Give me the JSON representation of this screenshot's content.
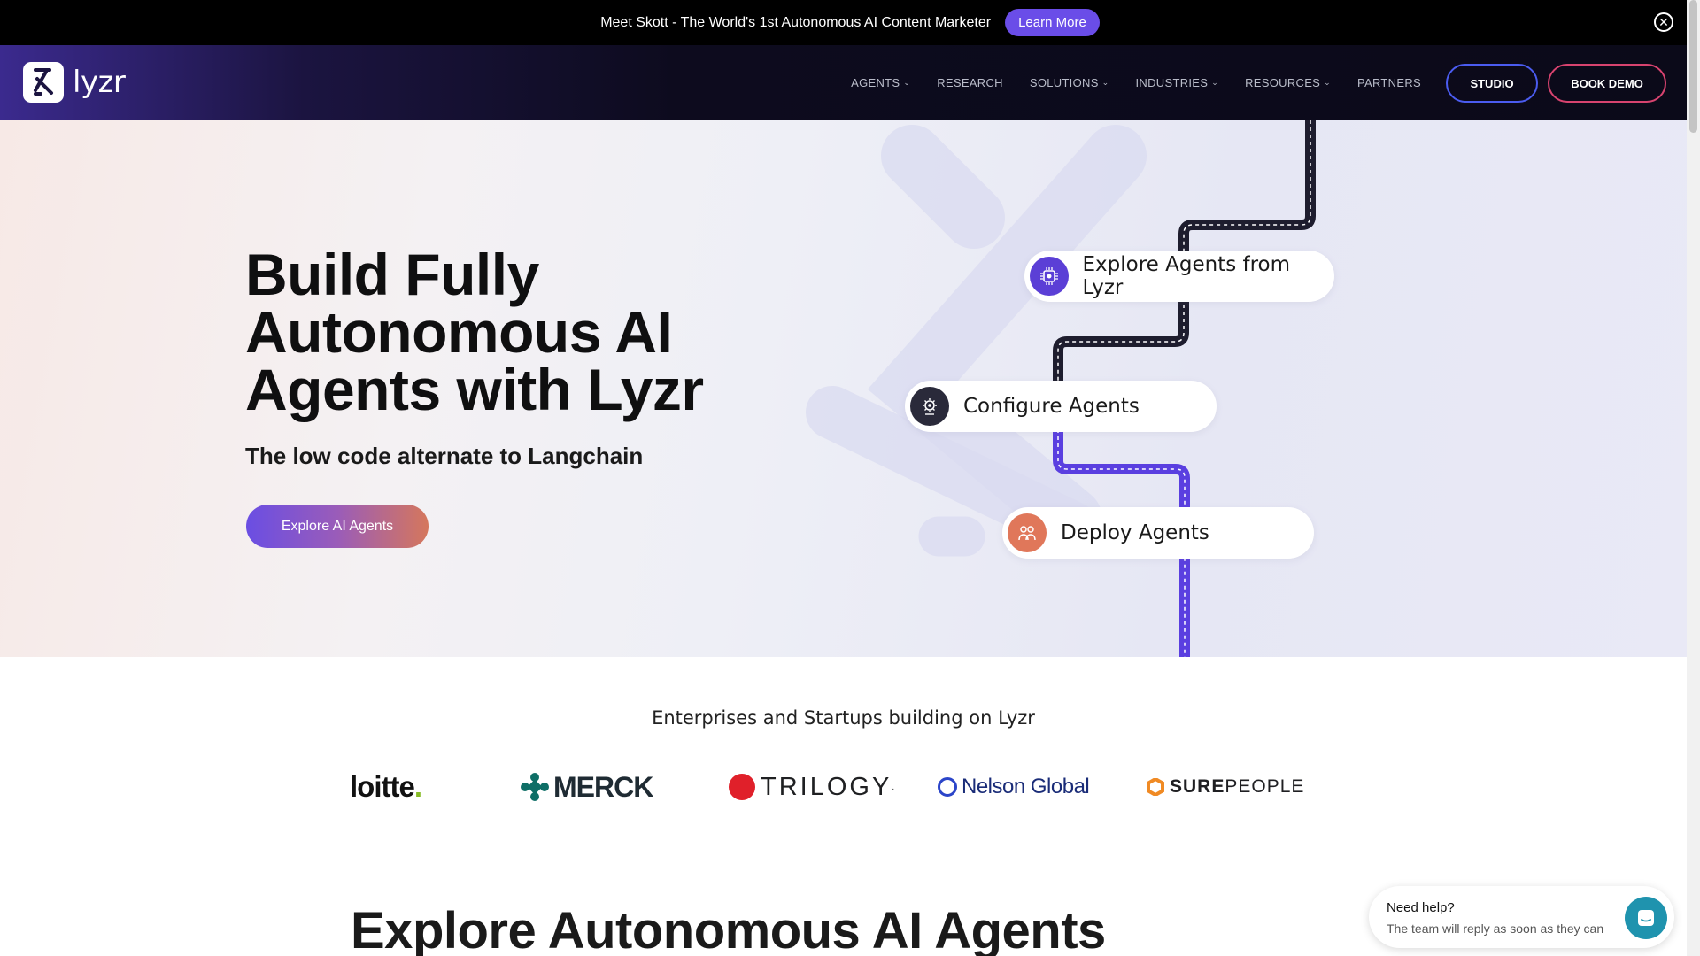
{
  "announcement": {
    "text": "Meet Skott - The World's 1st Autonomous AI Content Marketer",
    "button_label": "Learn More",
    "close_icon": "close-circle-icon"
  },
  "nav": {
    "logo_text": "lyzr",
    "items": [
      {
        "label": "AGENTS",
        "has_dropdown": true
      },
      {
        "label": "RESEARCH",
        "has_dropdown": false
      },
      {
        "label": "SOLUTIONS",
        "has_dropdown": true
      },
      {
        "label": "INDUSTRIES",
        "has_dropdown": true
      },
      {
        "label": "RESOURCES",
        "has_dropdown": true
      },
      {
        "label": "PARTNERS",
        "has_dropdown": false
      }
    ],
    "studio_label": "STUDIO",
    "demo_label": "BOOK DEMO"
  },
  "hero": {
    "title_lines": [
      "Build Fully",
      "Autonomous AI",
      "Agents with Lyzr"
    ],
    "subtitle": "The low code alternate to Langchain",
    "cta_label": "Explore AI Agents",
    "steps": [
      {
        "label": "Explore Agents from Lyzr",
        "icon": "chip-icon",
        "icon_color": "#5b3fd6"
      },
      {
        "label": "Configure Agents",
        "icon": "gear-brain-icon",
        "icon_color": "#2a2a3a"
      },
      {
        "label": "Deploy Agents",
        "icon": "people-icon",
        "icon_color": "#e0775a"
      }
    ]
  },
  "clients": {
    "title": "Enterprises and Startups building on Lyzr",
    "logos": [
      "Deloitte",
      "MERCK",
      "TRILOGY",
      "Nelson Global",
      "SUREPEOPLE"
    ]
  },
  "explore_section": {
    "title": "Explore Autonomous AI Agents"
  },
  "help_widget": {
    "title": "Need help?",
    "text": "The team will reply as soon as they can",
    "icon": "chat-icon"
  },
  "colors": {
    "accent": "#6a4de8",
    "studio_border": "#4b5cf0",
    "demo_border": "#d8436f"
  }
}
